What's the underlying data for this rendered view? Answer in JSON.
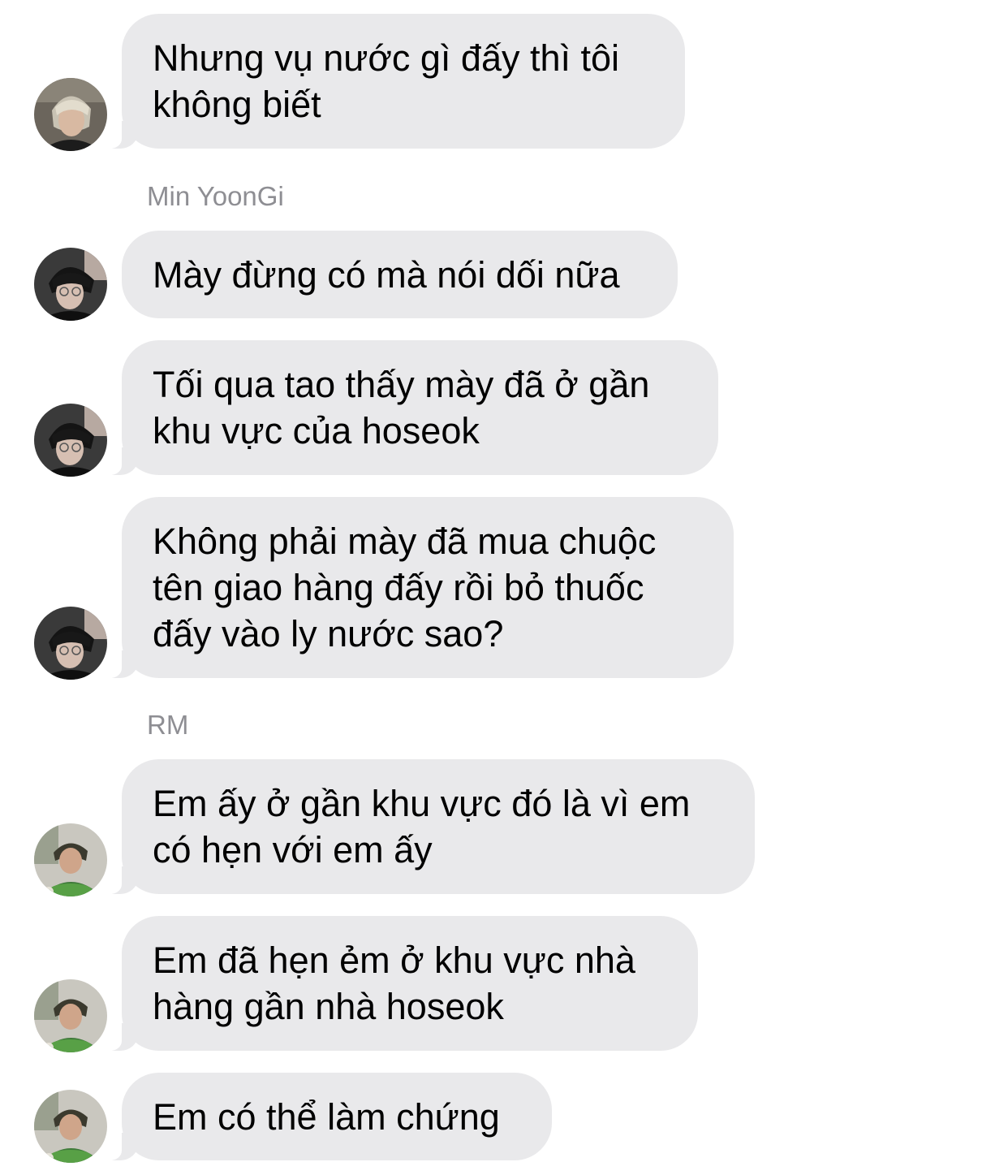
{
  "conversation": {
    "senders": {
      "min_yoongi": "Min YoonGi",
      "rm": "RM"
    },
    "messages": [
      {
        "avatar": "avatar-dark-blond",
        "text": "Nhưng vụ nước gì đấy thì tôi\nkhông biết"
      },
      {
        "avatar": "avatar-glasses-dark",
        "text": "Mày đừng có mà nói dối nữa"
      },
      {
        "avatar": "avatar-glasses-dark",
        "text": "Tối qua tao thấy mày đã ở gần\nkhu vực của hoseok"
      },
      {
        "avatar": "avatar-glasses-dark",
        "text": "Không phải mày đã mua chuộc\ntên giao hàng đấy rồi bỏ thuốc\nđấy vào ly nước sao?"
      },
      {
        "avatar": "avatar-green-shirt",
        "text": "Em ấy ở gần khu vực đó là vì em\ncó hẹn với em ấy"
      },
      {
        "avatar": "avatar-green-shirt",
        "text": "Em đã hẹn ẻm ở khu vực nhà\nhàng gần nhà hoseok"
      },
      {
        "avatar": "avatar-green-shirt",
        "text": "Em có thể làm chứng"
      }
    ]
  },
  "colors": {
    "bubble": "#e9e9eb",
    "sender_label": "#8e8e93",
    "text": "#000000"
  }
}
